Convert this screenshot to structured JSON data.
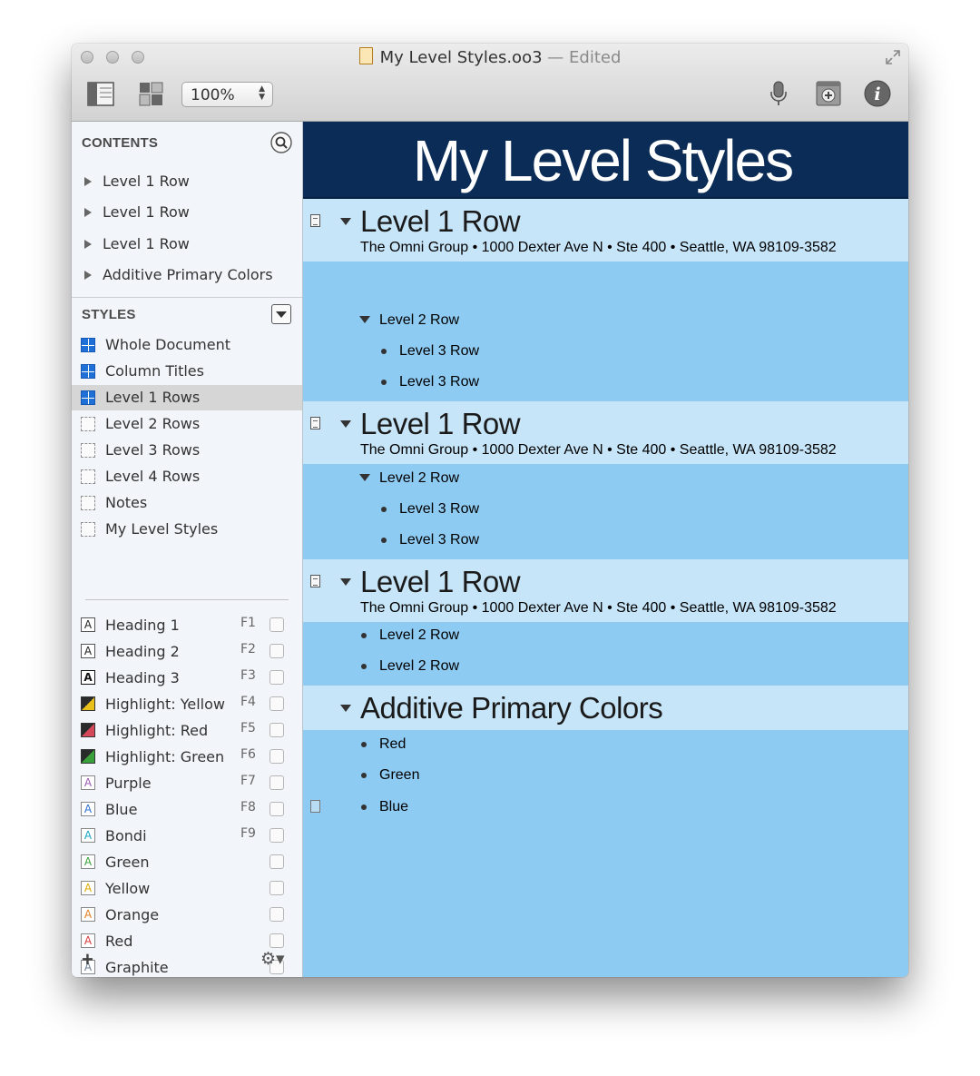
{
  "window": {
    "title": "My Level Styles.oo3",
    "status": "Edited",
    "zoom": "100%"
  },
  "sidebar": {
    "contents_header": "CONTENTS",
    "contents": [
      "Level 1 Row",
      "Level 1 Row",
      "Level 1 Row",
      "Additive Primary Colors"
    ],
    "styles_header": "STYLES",
    "styles": [
      {
        "label": "Whole Document",
        "icon": "blue-grid-icon"
      },
      {
        "label": "Column Titles",
        "icon": "blue-grid-icon"
      },
      {
        "label": "Level 1 Rows",
        "icon": "blue-grid-icon",
        "selected": true
      },
      {
        "label": "Level 2 Rows",
        "icon": "dashed-box-icon"
      },
      {
        "label": "Level 3 Rows",
        "icon": "dashed-box-icon"
      },
      {
        "label": "Level 4 Rows",
        "icon": "dashed-box-icon"
      },
      {
        "label": "Notes",
        "icon": "dashed-box-icon"
      },
      {
        "label": "My Level Styles",
        "icon": "dashed-box-icon"
      }
    ],
    "named_styles": [
      {
        "label": "Heading 1",
        "key": "F1",
        "glyph": "A",
        "color": "#222222",
        "kind": "heading1"
      },
      {
        "label": "Heading 2",
        "key": "F2",
        "glyph": "A",
        "color": "#222222",
        "kind": "heading2"
      },
      {
        "label": "Heading 3",
        "key": "F3",
        "glyph": "A",
        "color": "#111111",
        "kind": "heading3"
      },
      {
        "label": "Highlight: Yellow",
        "key": "F4",
        "glyph": "",
        "color": "#e9c01a",
        "kind": "highlight"
      },
      {
        "label": "Highlight: Red",
        "key": "F5",
        "glyph": "",
        "color": "#d4485a",
        "kind": "highlight"
      },
      {
        "label": "Highlight: Green",
        "key": "F6",
        "glyph": "",
        "color": "#3aa13a",
        "kind": "highlight"
      },
      {
        "label": "Purple",
        "key": "F7",
        "glyph": "A",
        "color": "#9b59b6",
        "kind": "color"
      },
      {
        "label": "Blue",
        "key": "F8",
        "glyph": "A",
        "color": "#2f6fd0",
        "kind": "color"
      },
      {
        "label": "Bondi",
        "key": "F9",
        "glyph": "A",
        "color": "#1aa3c8",
        "kind": "color"
      },
      {
        "label": "Green",
        "key": "",
        "glyph": "A",
        "color": "#3aa13a",
        "kind": "color"
      },
      {
        "label": "Yellow",
        "key": "",
        "glyph": "A",
        "color": "#e0a800",
        "kind": "color"
      },
      {
        "label": "Orange",
        "key": "",
        "glyph": "A",
        "color": "#e67e22",
        "kind": "color"
      },
      {
        "label": "Red",
        "key": "",
        "glyph": "A",
        "color": "#d63a3a",
        "kind": "color"
      },
      {
        "label": "Graphite",
        "key": "",
        "glyph": "A",
        "color": "#6b7c93",
        "kind": "color"
      }
    ],
    "footer": {
      "add": "+",
      "gear": "⚙▾"
    }
  },
  "outline": {
    "title": "My Level Styles",
    "note_text": "The Omni Group • 1000 Dexter Ave N • Ste 400 • Seattle, WA 98109-3582",
    "sections": [
      {
        "heading": "Level 1 Row",
        "level2": "Level 2 Row",
        "level3": [
          "Level 3 Row",
          "Level 3 Row"
        ]
      },
      {
        "heading": "Level 1 Row",
        "level2": "Level 2 Row",
        "level3": [
          "Level 3 Row",
          "Level 3 Row"
        ]
      },
      {
        "heading": "Level 1 Row",
        "children": [
          "Level 2 Row",
          "Level 2 Row"
        ]
      },
      {
        "heading": "Additive Primary Colors",
        "children": [
          "Red",
          "Green",
          "Blue"
        ]
      }
    ]
  }
}
